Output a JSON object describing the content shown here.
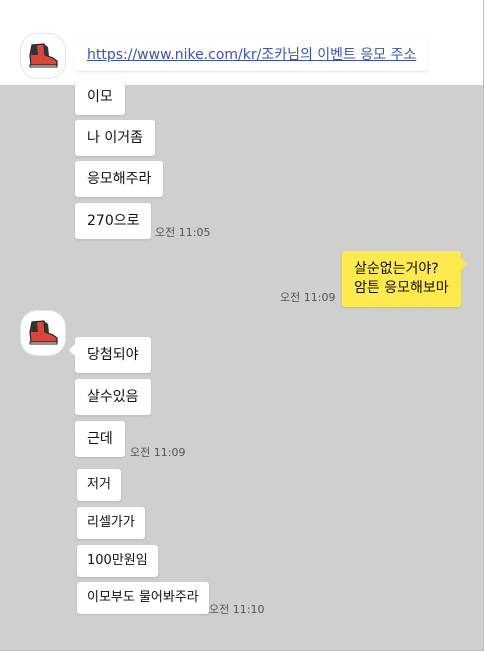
{
  "chat": {
    "link": "https://www.nike.com/kr/조카님의 이벤트 응모 주소",
    "group1": [
      "이모",
      "나 이거좀",
      "응모해주라",
      "270으로"
    ],
    "group1_time": "오전 11:05",
    "mine_lines": [
      "살순없는거야?",
      "암튼 응모해보마"
    ],
    "mine_time": "오전 11:09",
    "group2": [
      "당첨되야",
      "살수있음",
      "근데"
    ],
    "group2_time": "오전 11:09",
    "group3": [
      "저거",
      "리셀가가",
      "100만원임",
      "이모부도 물어봐주라"
    ],
    "group3_time": "오전 11:10"
  },
  "icons": {
    "avatar": "sneaker-icon"
  },
  "colors": {
    "chat_bg": "#cfcfcf",
    "my_bubble": "#fee94e",
    "link": "#3a53b8"
  }
}
